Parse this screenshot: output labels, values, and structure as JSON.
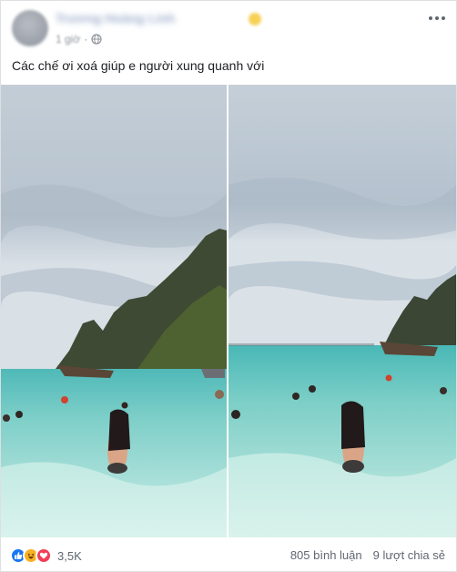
{
  "post": {
    "author": "Trương Hoàng Linh",
    "time": "1 giờ",
    "caption": "Các chế ơi xoá giúp e người xung quanh với",
    "images": [
      {
        "alt": "Beach photo with other people"
      },
      {
        "alt": "Beach photo with people removed"
      }
    ]
  },
  "footer": {
    "reaction_count": "3,5K",
    "comments": "805 bình luận",
    "shares": "9 lượt chia sẻ"
  },
  "icons": {
    "reactions": [
      "like-icon",
      "haha-icon",
      "love-icon"
    ],
    "privacy": "globe-icon",
    "menu": "more-options-icon"
  },
  "colors": {
    "link": "#4b67a1",
    "like": "#1877f2",
    "haha": "#f7b125",
    "love": "#f33e58",
    "muted": "#606770"
  }
}
